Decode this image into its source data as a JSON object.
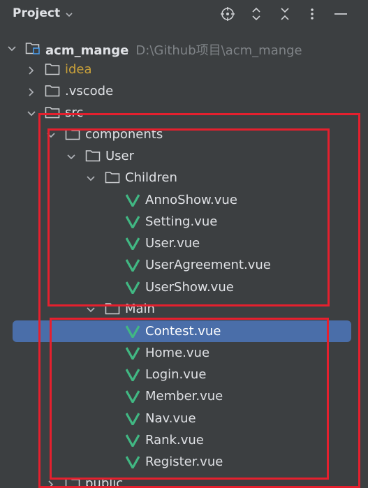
{
  "header": {
    "title": "Project",
    "icons": [
      "crosshair-icon",
      "expand-icon",
      "collapse-icon",
      "more-icon",
      "minimize-icon"
    ]
  },
  "tree": {
    "root": {
      "label": "acm_mange",
      "path": "D:\\Github项目\\acm_mange"
    },
    "idea": "idea",
    "vscode": ".vscode",
    "src": "src",
    "components": "components",
    "user": "User",
    "children": "Children",
    "children_files": [
      "AnnoShow.vue",
      "Setting.vue",
      "User.vue",
      "UserAgreement.vue",
      "UserShow.vue"
    ],
    "main": "Main",
    "main_files": [
      "Contest.vue",
      "Home.vue",
      "Login.vue",
      "Member.vue",
      "Nav.vue",
      "Rank.vue",
      "Register.vue"
    ],
    "public": "public"
  },
  "selected": "Contest.vue",
  "colors": {
    "background": "#3c3f41",
    "selection": "#4a6ea9",
    "highlight_box": "#e5202e",
    "vue_green": "#41b883",
    "folder_idea": "#c9a13a"
  }
}
